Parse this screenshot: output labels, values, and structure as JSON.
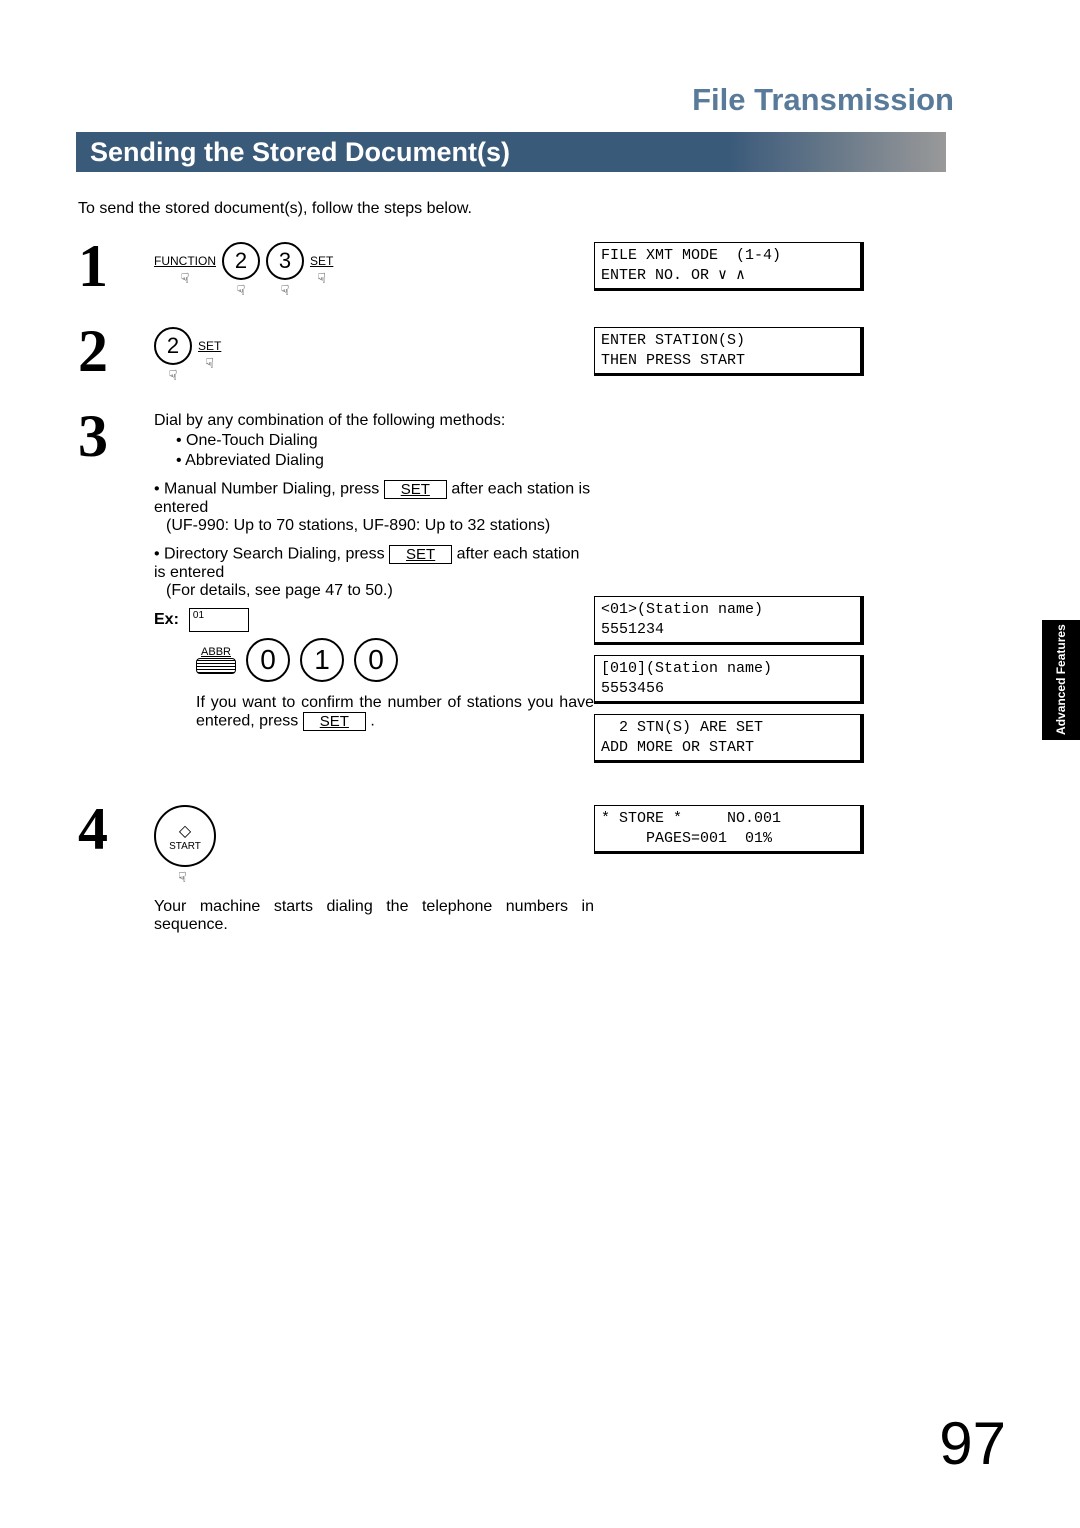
{
  "page": {
    "heading": "File Transmission",
    "section_title": "Sending the Stored Document(s)",
    "intro": "To send the stored document(s), follow the steps below.",
    "side_tab": "Advanced\nFeatures",
    "page_number": "97"
  },
  "step1": {
    "num": "1",
    "function_label": "FUNCTION",
    "key_a": "2",
    "key_b": "3",
    "set_label": "SET",
    "lcd_line1": "FILE XMT MODE  (1-4)",
    "lcd_line2": "ENTER NO. OR ∨ ∧"
  },
  "step2": {
    "num": "2",
    "key": "2",
    "set_label": "SET",
    "lcd_line1": "ENTER STATION(S)",
    "lcd_line2": "THEN PRESS START"
  },
  "step3": {
    "num": "3",
    "intro": "Dial by any combination of the following methods:",
    "bullet1": "One-Touch Dialing",
    "bullet2": "Abbreviated Dialing",
    "bullet3_pre": "Manual Number Dialing, press ",
    "bullet3_set": "SET",
    "bullet3_post": " after each station is entered",
    "bullet3_note": "(UF-990: Up to 70 stations, UF-890: Up to 32 stations)",
    "bullet4_pre": "Directory Search Dialing, press ",
    "bullet4_set": "SET",
    "bullet4_post": " after each station is entered",
    "bullet4_note": "(For details, see page 47 to 50.)",
    "ex_label": "Ex:",
    "one_touch": "01",
    "abbr_label": "ABBR",
    "digit1": "0",
    "digit2": "1",
    "digit3": "0",
    "confirm_pre": "If you want to confirm the number of stations you have entered, press ",
    "confirm_set": "SET",
    "confirm_post": " .",
    "lcd1_line1": "<01>(Station name)",
    "lcd1_line2": "5551234",
    "lcd2_line1": "[010](Station name)",
    "lcd2_line2": "5553456",
    "lcd3_line1": "  2 STN(S) ARE SET",
    "lcd3_line2": "ADD MORE OR START"
  },
  "step4": {
    "num": "4",
    "start_label": "START",
    "body": "Your machine starts dialing the telephone numbers in sequence.",
    "lcd_line1": "* STORE *     NO.001",
    "lcd_line2": "     PAGES=001  01%"
  }
}
